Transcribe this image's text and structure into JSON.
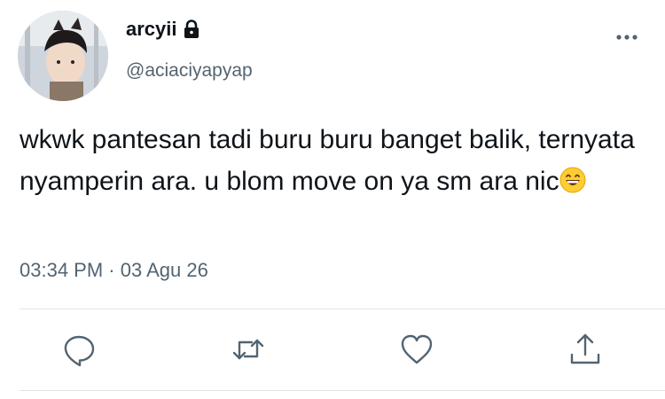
{
  "user": {
    "display_name": "arcyii",
    "handle": "@aciaciyapyap",
    "protected_icon": "lock-icon",
    "avatar": "profile-photo"
  },
  "tweet": {
    "text": "wkwk pantesan tadi buru buru banget balik, ternyata nyamperin ara. u blom move on ya sm ara nic",
    "emoji": "😄",
    "time": "03:34 PM",
    "separator": "·",
    "date": "03 Agu 26"
  },
  "actions": [
    {
      "icon": "reply-icon"
    },
    {
      "icon": "retweet-icon"
    },
    {
      "icon": "like-icon"
    },
    {
      "icon": "share-icon"
    }
  ],
  "menu_icon": "more-options-icon",
  "colors": {
    "text": "#0f1419",
    "secondary": "#536471",
    "divider": "#dfe3e7",
    "icon": "#536471"
  }
}
